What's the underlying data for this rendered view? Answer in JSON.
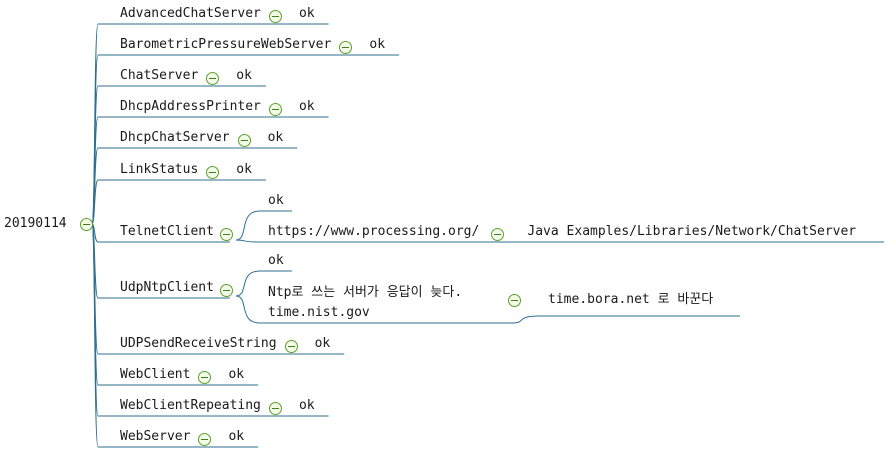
{
  "colors": {
    "edge": "#2f6f8f",
    "toggle_border": "#5aa02c",
    "text": "#1a1a1a"
  },
  "icon": "collapse-minus-icon",
  "root": {
    "label": "20190114"
  },
  "branches": [
    {
      "label": "AdvancedChatServer",
      "children": [
        {
          "label": "ok"
        }
      ]
    },
    {
      "label": "BarometricPressureWebServer",
      "children": [
        {
          "label": "ok"
        }
      ]
    },
    {
      "label": "ChatServer",
      "children": [
        {
          "label": "ok"
        }
      ]
    },
    {
      "label": "DhcpAddressPrinter",
      "children": [
        {
          "label": "ok"
        }
      ]
    },
    {
      "label": "DhcpChatServer",
      "children": [
        {
          "label": "ok"
        }
      ]
    },
    {
      "label": "LinkStatus",
      "children": [
        {
          "label": "ok"
        }
      ]
    },
    {
      "label": "TelnetClient",
      "children": [
        {
          "label": "ok"
        },
        {
          "label": "https://www.processing.org/",
          "children": [
            {
              "label": "Java Examples/Libraries/Network/ChatServer"
            }
          ]
        }
      ]
    },
    {
      "label": "UdpNtpClient",
      "children": [
        {
          "label": "ok"
        },
        {
          "label": "Ntp로 쓰는 서버가 응답이 늦다.\ntime.nist.gov",
          "children": [
            {
              "label": "time.bora.net 로 바꾼다"
            }
          ]
        }
      ]
    },
    {
      "label": "UDPSendReceiveString",
      "children": [
        {
          "label": "ok"
        }
      ]
    },
    {
      "label": "WebClient",
      "children": [
        {
          "label": "ok"
        }
      ]
    },
    {
      "label": "WebClientRepeating",
      "children": [
        {
          "label": "ok"
        }
      ]
    },
    {
      "label": "WebServer",
      "children": [
        {
          "label": "ok"
        }
      ]
    }
  ]
}
